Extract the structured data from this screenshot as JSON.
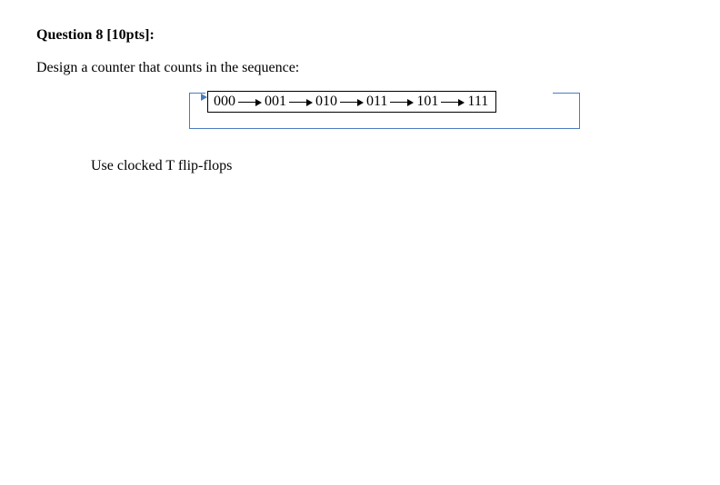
{
  "heading": "Question 8 [10pts]:",
  "prompt": "Design a counter that counts in the sequence:",
  "states": [
    "000",
    "001",
    "010",
    "011",
    "101",
    "111"
  ],
  "note": "Use clocked T flip-flops"
}
